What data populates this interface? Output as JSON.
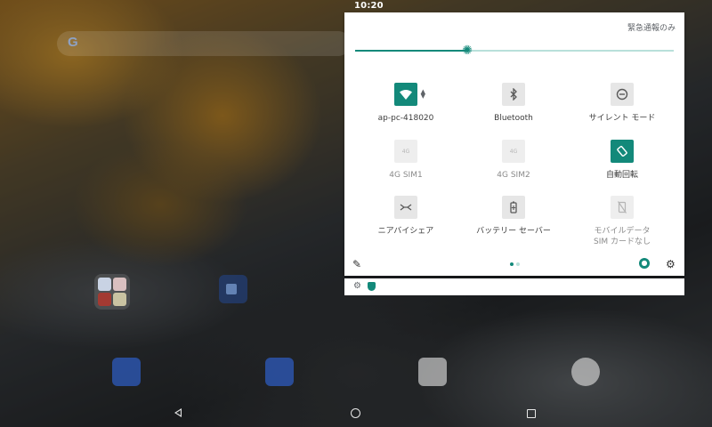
{
  "status_bar": {
    "time": "10:20"
  },
  "quick_settings": {
    "emergency_label": "緊急通報のみ",
    "brightness": {
      "level_fraction": 0.35,
      "icon": "brightness-icon"
    },
    "tiles": [
      {
        "label": "ap-pc-418020",
        "icon": "wifi-icon",
        "state": "on"
      },
      {
        "label": "Bluetooth",
        "icon": "bluetooth-icon",
        "state": "off"
      },
      {
        "label": "サイレント モード",
        "icon": "do-not-disturb-icon",
        "state": "off"
      },
      {
        "label": "4G SIM1",
        "icon": "4g-icon",
        "state": "disabled"
      },
      {
        "label": "4G SIM2",
        "icon": "4g-icon",
        "state": "disabled"
      },
      {
        "label": "自動回転",
        "icon": "auto-rotate-icon",
        "state": "on"
      },
      {
        "label": "ニアバイシェア",
        "icon": "nearby-share-icon",
        "state": "off"
      },
      {
        "label": "バッテリー セーバー",
        "icon": "battery-saver-icon",
        "state": "off"
      },
      {
        "label": "モバイルデータ",
        "label2": "SIM カードなし",
        "icon": "mobile-data-off-icon",
        "state": "disabled"
      }
    ],
    "tile_glyphs": {
      "sim_badge": "4G"
    },
    "footer": {
      "edit_icon": "pencil-icon",
      "user_icon": "user-icon",
      "settings_icon": "gear-icon",
      "page_count": 2,
      "active_page": 1
    },
    "accent_color": "#13897a"
  },
  "notification_strip": {
    "icons": [
      "gear-icon",
      "shield-icon"
    ]
  },
  "navigation_bar": {
    "buttons": [
      "back",
      "home",
      "recents"
    ]
  }
}
